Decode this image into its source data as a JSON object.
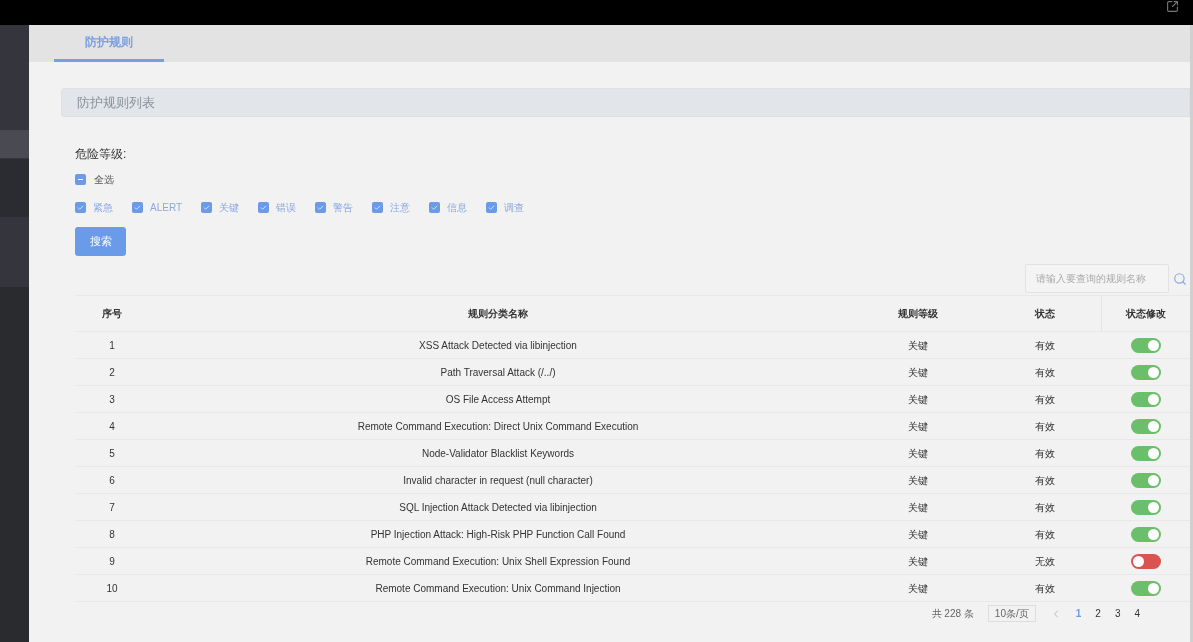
{
  "tabs": [
    {
      "label": "防护规则",
      "selected": true
    }
  ],
  "panel_title": "防护规则列表",
  "filter": {
    "label": "危险等级:",
    "select_all": {
      "label": "全选",
      "indeterminate": true
    },
    "levels": [
      {
        "label": "紧急",
        "checked": true
      },
      {
        "label": "ALERT",
        "checked": true
      },
      {
        "label": "关键",
        "checked": true
      },
      {
        "label": "错误",
        "checked": true
      },
      {
        "label": "警告",
        "checked": true
      },
      {
        "label": "注意",
        "checked": true
      },
      {
        "label": "信息",
        "checked": true
      },
      {
        "label": "调查",
        "checked": true
      }
    ],
    "search_button": "搜索"
  },
  "search": {
    "placeholder": "请输入要查询的规则名称"
  },
  "table": {
    "columns": [
      "序号",
      "规则分类名称",
      "规则等级",
      "状态",
      "状态修改"
    ],
    "rows": [
      {
        "index": "1",
        "name": "XSS Attack Detected via libinjection",
        "level": "关键",
        "status": "有效",
        "on": true
      },
      {
        "index": "2",
        "name": "Path Traversal Attack (/../)",
        "level": "关键",
        "status": "有效",
        "on": true
      },
      {
        "index": "3",
        "name": "OS File Access Attempt",
        "level": "关键",
        "status": "有效",
        "on": true
      },
      {
        "index": "4",
        "name": "Remote Command Execution: Direct Unix Command Execution",
        "level": "关键",
        "status": "有效",
        "on": true
      },
      {
        "index": "5",
        "name": "Node-Validator Blacklist Keywords",
        "level": "关键",
        "status": "有效",
        "on": true
      },
      {
        "index": "6",
        "name": "Invalid character in request (null character)",
        "level": "关键",
        "status": "有效",
        "on": true
      },
      {
        "index": "7",
        "name": "SQL Injection Attack Detected via libinjection",
        "level": "关键",
        "status": "有效",
        "on": true
      },
      {
        "index": "8",
        "name": "PHP Injection Attack: High-Risk PHP Function Call Found",
        "level": "关键",
        "status": "有效",
        "on": true
      },
      {
        "index": "9",
        "name": "Remote Command Execution: Unix Shell Expression Found",
        "level": "关键",
        "status": "无效",
        "on": false
      },
      {
        "index": "10",
        "name": "Remote Command Execution: Unix Command Injection",
        "level": "关键",
        "status": "有效",
        "on": true
      }
    ]
  },
  "pagination": {
    "total": "共 228 条",
    "page_size": "10条/页",
    "pages": [
      {
        "label": "1",
        "selected": true
      },
      {
        "label": "2",
        "selected": false
      },
      {
        "label": "3",
        "selected": false
      },
      {
        "label": "4",
        "selected": false
      }
    ]
  }
}
